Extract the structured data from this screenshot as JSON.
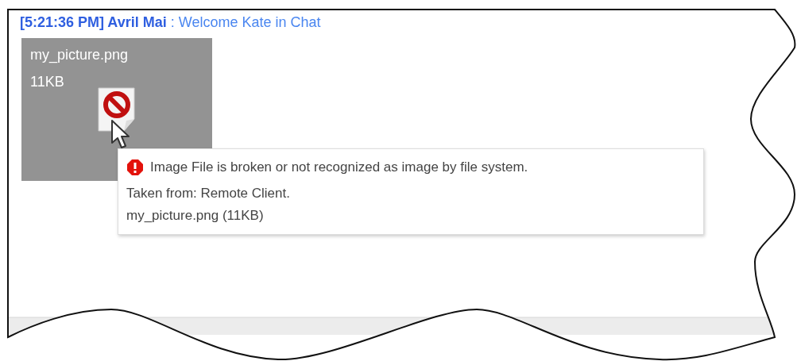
{
  "message": {
    "header": "**[5:21:36 PM] Avril Mai** : Welcome Kate in Chat"
  },
  "attachment": {
    "name": "my_picture.png",
    "size": "11KB"
  },
  "tooltip": {
    "error": "Image File is broken or not recognized as image by file system.",
    "source": "Taken from: Remote Client.",
    "file": "my_picture.png (11KB)"
  }
}
